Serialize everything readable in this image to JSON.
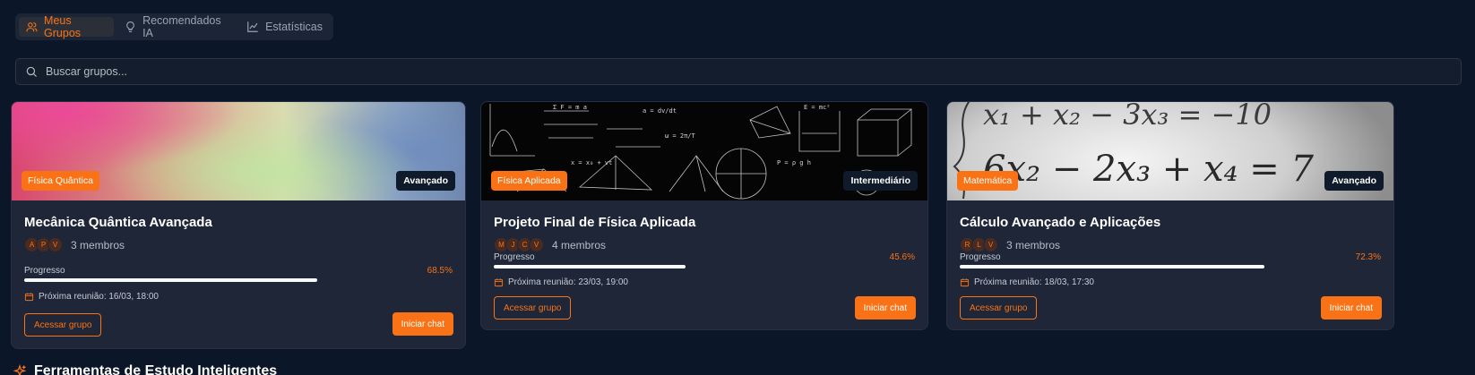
{
  "tabs": [
    {
      "label": "Meus Grupos",
      "icon": "users-icon",
      "active": true
    },
    {
      "label": "Recomendados IA",
      "icon": "lightbulb-icon",
      "active": false
    },
    {
      "label": "Estatísticas",
      "icon": "chart-line-icon",
      "active": false
    }
  ],
  "search": {
    "placeholder": "Buscar grupos..."
  },
  "colors": {
    "accent": "#f97316",
    "background": "#0b1628",
    "card": "#1e2637"
  },
  "groups": [
    {
      "category": "Física Quântica",
      "level": "Avançado",
      "title": "Mecânica Quântica Avançada",
      "avatars": [
        "A",
        "P",
        "V"
      ],
      "members": "3 membros",
      "progress_label": "Progresso",
      "progress_pct": "68.5%",
      "progress_value": 0.685,
      "meeting": "Próxima reunião: 16/03, 18:00",
      "access_label": "Acessar grupo",
      "chat_label": "Iniciar chat"
    },
    {
      "category": "Física Aplicada",
      "level": "Intermediário",
      "title": "Projeto Final de Física Aplicada",
      "avatars": [
        "M",
        "J",
        "C",
        "V"
      ],
      "members": "4 membros",
      "progress_label": "Progresso",
      "progress_pct": "45.6%",
      "progress_value": 0.456,
      "meeting": "Próxima reunião: 23/03, 19:00",
      "access_label": "Acessar grupo",
      "chat_label": "Iniciar chat"
    },
    {
      "category": "Matemática",
      "level": "Avançado",
      "title": "Cálculo Avançado e Aplicações",
      "avatars": [
        "R",
        "L",
        "V"
      ],
      "members": "3 membros",
      "progress_label": "Progresso",
      "progress_pct": "72.3%",
      "progress_value": 0.723,
      "meeting": "Próxima reunião: 18/03, 17:30",
      "access_label": "Acessar grupo",
      "chat_label": "Iniciar chat"
    }
  ],
  "section": {
    "title": "Ferramentas de Estudo Inteligentes",
    "icon": "sparkles-icon"
  },
  "formula_text": {
    "line1": "x₁ + x₂ − 3x₃ = −10",
    "line2": "6x₂ − 2x₃ + x₄ = 7"
  }
}
